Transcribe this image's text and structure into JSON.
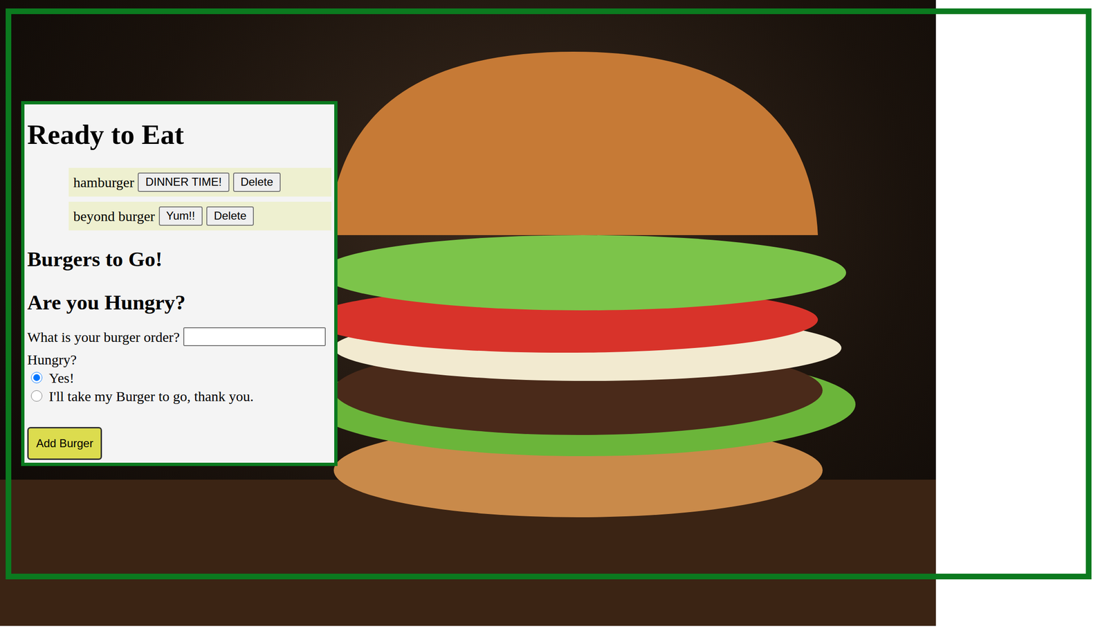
{
  "panel": {
    "title": "Ready to Eat",
    "items": [
      {
        "name": "hamburger",
        "action": "DINNER TIME!",
        "delete": "Delete"
      },
      {
        "name": "beyond burger",
        "action": "Yum!!",
        "delete": "Delete"
      }
    ],
    "togo_heading": "Burgers to Go!",
    "form": {
      "heading": "Are you Hungry?",
      "label": "What is your burger order?",
      "hungry_label": "Hungry?",
      "options": [
        {
          "label": "Yes!",
          "selected": true
        },
        {
          "label": "I'll take my Burger to go, thank you.",
          "selected": false
        }
      ],
      "submit": "Add Burger"
    }
  }
}
